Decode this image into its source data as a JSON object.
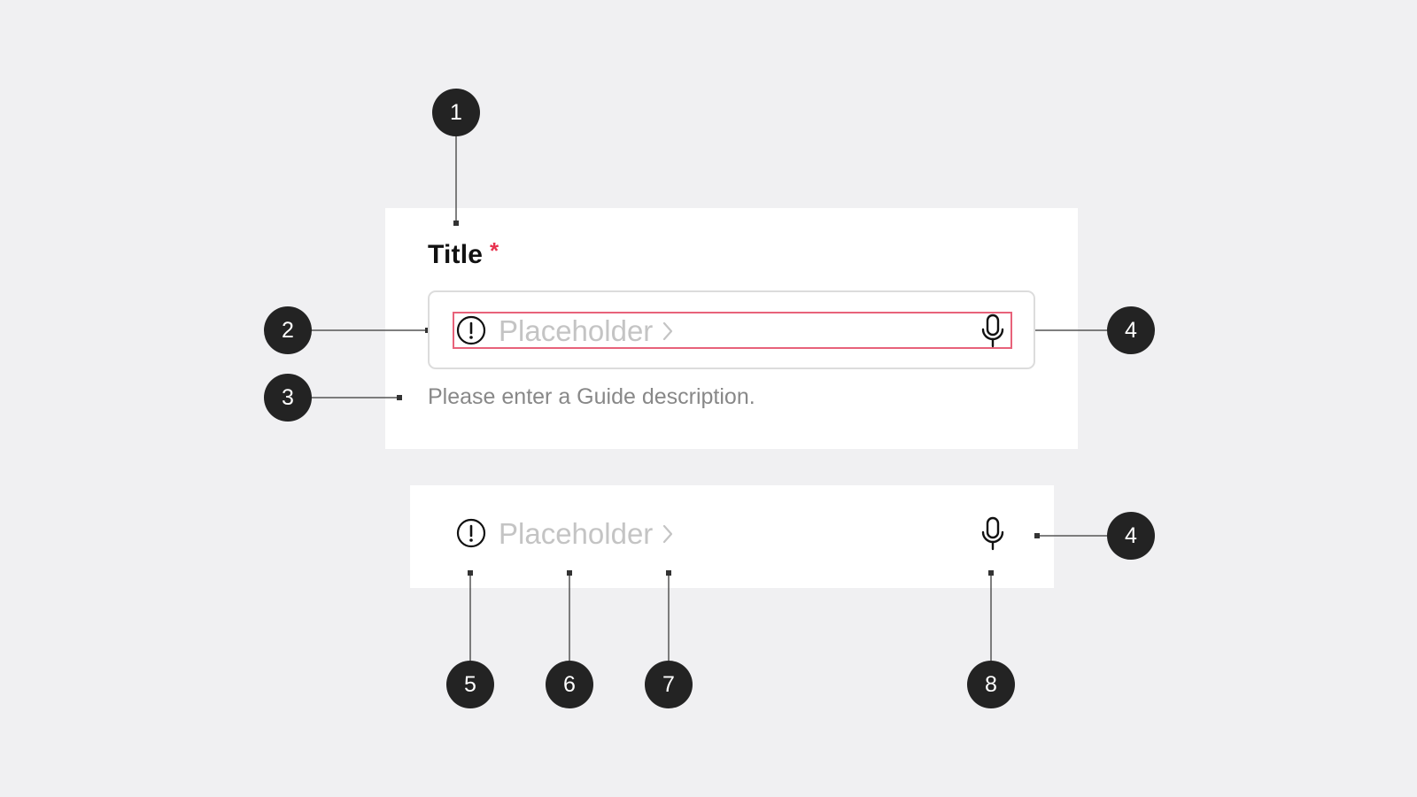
{
  "field": {
    "label": "Title",
    "required_mark": "*",
    "placeholder": "Placeholder",
    "helper_text": "Please enter a Guide description."
  },
  "callouts": [
    "1",
    "2",
    "3",
    "4",
    "4",
    "5",
    "6",
    "7",
    "8"
  ],
  "icons": {
    "leading": "alert-circle-icon",
    "trailing_chevron": "chevron-right-icon",
    "trailing": "microphone-icon"
  },
  "colors": {
    "background": "#f0f0f2",
    "required": "#e8324f",
    "focus_outline": "#e8627a",
    "callout": "#232323",
    "placeholder": "#c4c4c4",
    "helper": "#888888"
  }
}
